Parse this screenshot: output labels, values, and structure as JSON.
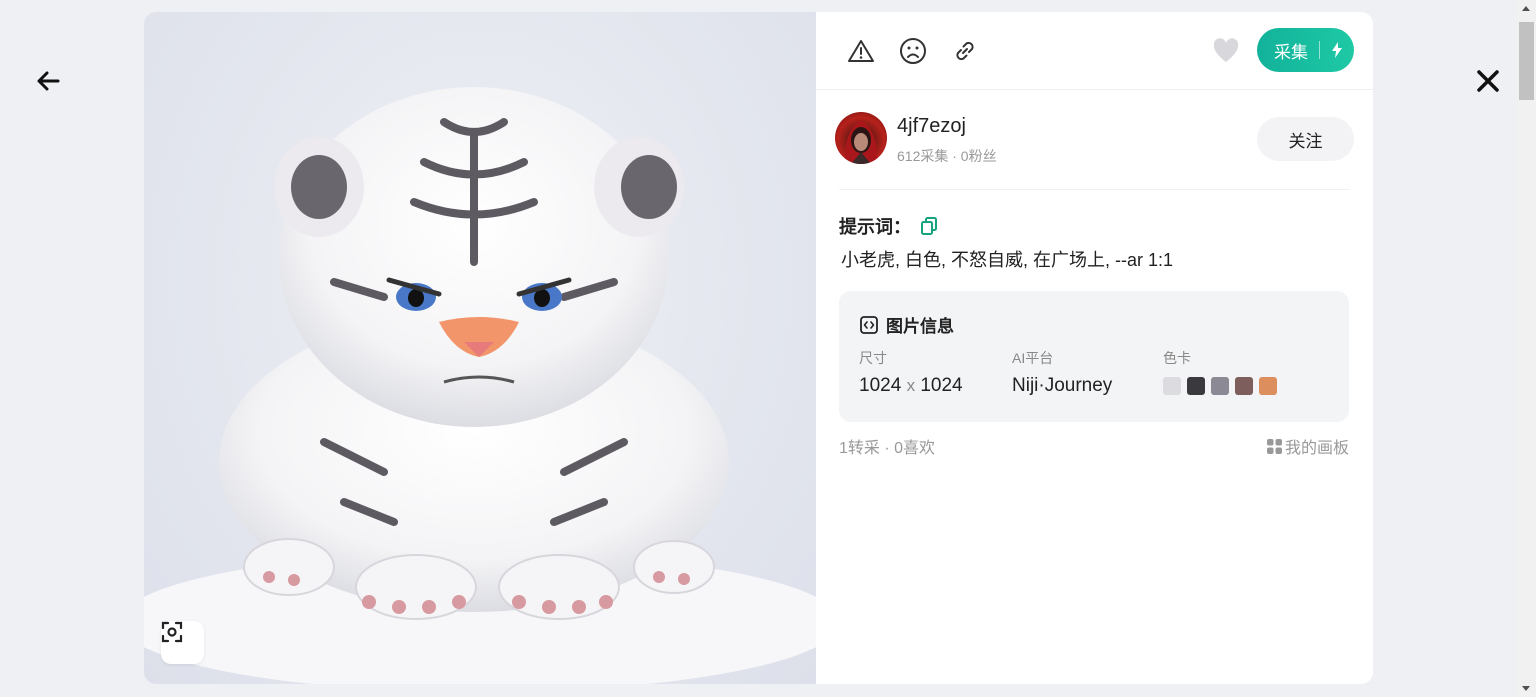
{
  "nav": {
    "back_icon": "arrow-left-icon",
    "close_icon": "close-x-icon"
  },
  "toolbar": {
    "icons": [
      "report-warning-icon",
      "dislike-sad-face-icon",
      "link-icon"
    ],
    "like_icon": "heart-icon",
    "collect_label": "采集",
    "collect_icon": "lightning-icon",
    "accent_color": "#16bd9f"
  },
  "user": {
    "name": "4jf7ezoj",
    "stats": "612采集 · 0粉丝",
    "follow_label": "关注"
  },
  "prompt": {
    "title": "提示词：",
    "copy_icon": "copy-icon",
    "text": "小老虎, 白色, 不怒自威, 在广场上,  --ar 1:1"
  },
  "image_info": {
    "title": "图片信息",
    "icon": "code-box-icon",
    "size_label": "尺寸",
    "width": "1024",
    "x": "x",
    "height": "1024",
    "platform_label": "AI平台",
    "platform": "Niji·Journey",
    "palette_label": "色卡",
    "palette": [
      "#dcdce0",
      "#3a393e",
      "#8b8993",
      "#7d5e5c",
      "#dc8e5c"
    ]
  },
  "footer": {
    "stats": "1转采 · 0喜欢",
    "board_icon": "grid-icon",
    "board_label": "我的画板"
  },
  "image": {
    "zoom_icon": "focus-scan-icon"
  }
}
